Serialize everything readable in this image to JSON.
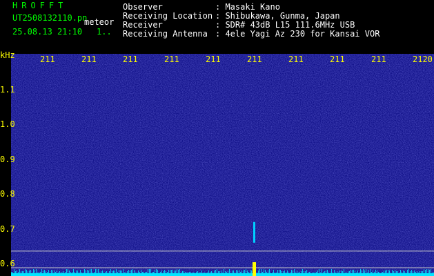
{
  "header": {
    "title": "HROFFT",
    "filename": "UT2508132110.pn",
    "tag": "meteor",
    "datetime": "25.08.13 21:10",
    "count": "1.."
  },
  "metadata": [
    {
      "label": "Observer",
      "value": ": Masaki Kano"
    },
    {
      "label": "Receiving Location",
      "value": ": Shibukawa, Gunma, Japan"
    },
    {
      "label": "Receiver",
      "value": ": SDR# 43dB L15 111.6MHz USB"
    },
    {
      "label": "Receiving Antenna",
      "value": ": 4ele Yagi Az 230 for Kansai VOR"
    }
  ],
  "colors": {
    "background": "#000000",
    "spectrogram_base": "#12128a",
    "noise_floor": "#00e5ff",
    "meteor_echo": "#ffff00",
    "axis_labels": "#ffff00",
    "header_green": "#00ff00"
  },
  "chart_data": {
    "type": "heatmap",
    "ylabel": "kHz",
    "x_ticks": [
      "211",
      "211",
      "211",
      "211",
      "211",
      "211",
      "211",
      "211",
      "211",
      "2120"
    ],
    "y_ticks": [
      "1.1",
      "1.0",
      "0.9",
      "0.8",
      "0.7",
      "0.6"
    ],
    "ylim": [
      0.58,
      1.15
    ],
    "reference_lines_khz": [
      0.62,
      0.6,
      0.58
    ],
    "meteor_echo": {
      "x_index": 4.2,
      "y_khz": [
        0.58,
        0.66
      ]
    }
  }
}
